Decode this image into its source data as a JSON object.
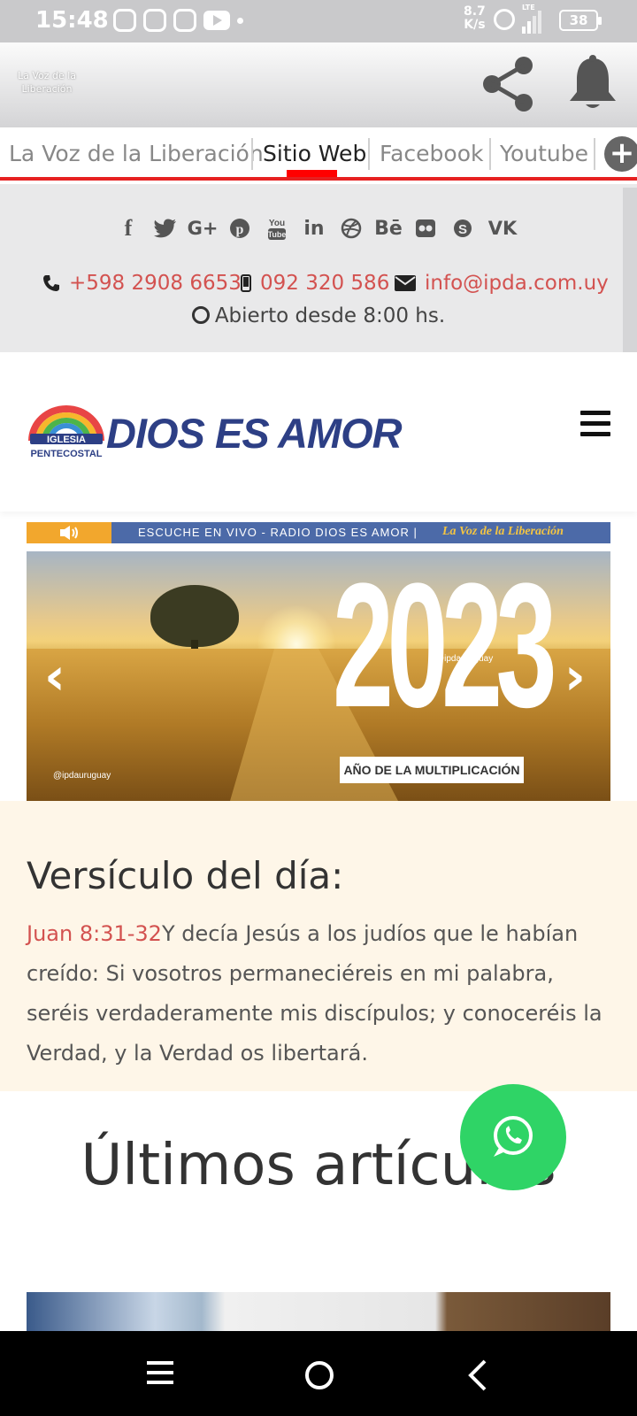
{
  "status_bar": {
    "time": "15:48",
    "net_speed_value": "8.7",
    "net_speed_unit": "K/s",
    "network": "LTE",
    "battery": "38"
  },
  "app_header": {
    "title": "La Voz de la Liberación",
    "icons": [
      "share-icon",
      "bell-icon"
    ]
  },
  "tabs": [
    {
      "label": "La Voz de la Liberación",
      "active": false
    },
    {
      "label": "Sitio Web",
      "active": true
    },
    {
      "label": "Facebook",
      "active": false
    },
    {
      "label": "Youtube",
      "active": false
    }
  ],
  "tab_add": "+",
  "info": {
    "social_icons": [
      "facebook-icon",
      "twitter-icon",
      "google-plus-icon",
      "pinterest-icon",
      "youtube-icon",
      "linkedin-icon",
      "dribbble-icon",
      "behance-icon",
      "flickr-icon",
      "skype-icon",
      "vk-icon"
    ],
    "phone": "+598 2908 6653",
    "mobile": "092 320 586",
    "email": "info@ipda.com.uy",
    "hours": "Abierto desde 8:00 hs."
  },
  "logo": {
    "iglesia": "IGLESIA",
    "pentecostal": "PENTECOSTAL",
    "brand": "DIOS ES AMOR"
  },
  "radio": {
    "text": "ESCUCHE EN VIVO - RADIO DIOS ES AMOR |",
    "tag": "La Voz de la Liberación"
  },
  "slider": {
    "year": "2023",
    "subtitle": "AÑO DE LA MULTIPLICACIÓN",
    "handle": "@ipdauruguay",
    "prev": "‹",
    "next": "›"
  },
  "verse": {
    "title": "Versículo del día:",
    "reference": "Juan 8:31-32",
    "text": "Y decía Jesús a los judíos que le habían creído: Si vosotros permaneciéreis en mi palabra, seréis verdaderamente mis discípulos; y conoceréis la Verdad, y la Verdad os libertará."
  },
  "articles": {
    "title": "Últimos artículos"
  },
  "colors": {
    "accent_red": "#d35250",
    "tab_red": "#e62020",
    "brand_blue": "#2d3f85",
    "whatsapp_green": "#2fd466"
  }
}
